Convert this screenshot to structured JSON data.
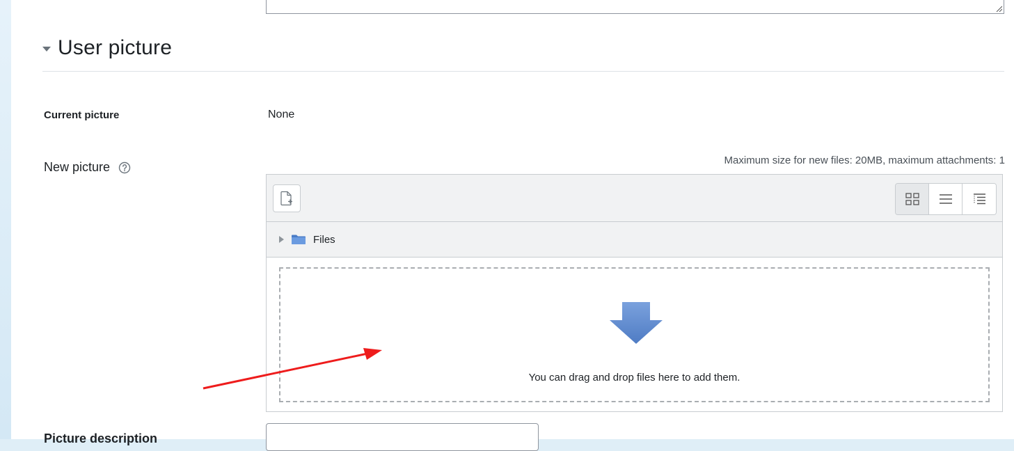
{
  "section": {
    "title": "User picture"
  },
  "fields": {
    "current_picture_label": "Current picture",
    "current_picture_value": "None",
    "new_picture_label": "New picture",
    "picture_description_label": "Picture description",
    "picture_description_value": ""
  },
  "filepicker": {
    "max_size_note": "Maximum size for new files: 20MB, maximum attachments: 1",
    "path_label": "Files",
    "drop_text": "You can drag and drop files here to add them.",
    "view_modes": [
      "icons-view",
      "list-view",
      "tree-view"
    ],
    "active_view": "icons-view"
  },
  "icons": {
    "caret": "caret-down-icon",
    "help": "help-question-icon",
    "add_file": "add-file-icon",
    "folder": "folder-icon",
    "drop": "drop-arrow-icon"
  },
  "colors": {
    "drop_arrow": "#5b86c9",
    "annotation_arrow": "#ee1c1c",
    "folder": "#4a7cc7"
  }
}
